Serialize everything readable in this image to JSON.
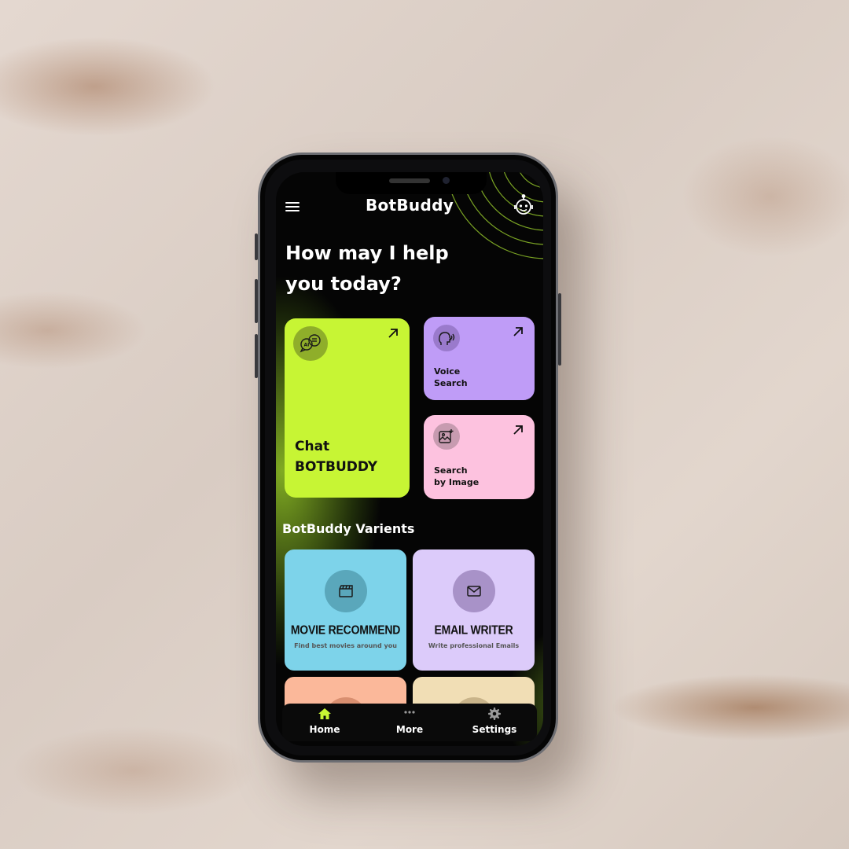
{
  "app": {
    "title": "BotBuddy"
  },
  "greeting": {
    "line1": "How may I help",
    "line2": "you today?"
  },
  "cards": {
    "chat": {
      "line1": "Chat",
      "line2": "BOTBUDDY",
      "icon": "ai-chat-icon",
      "color": "#c7f534"
    },
    "voice": {
      "line1": "Voice",
      "line2": "Search",
      "icon": "voice-head-icon",
      "color": "#bf9cf7"
    },
    "image": {
      "line1": "Search",
      "line2": "by Image",
      "icon": "image-search-icon",
      "color": "#fdc2df"
    }
  },
  "variants": {
    "title": "BotBuddy Varients",
    "items": [
      {
        "name": "MOVIE RECOMMEND",
        "desc": "Find best movies around you",
        "icon": "clapperboard-icon",
        "color": "#7dd3ea"
      },
      {
        "name": "EMAIL WRITER",
        "desc": "Write professional Emails",
        "icon": "mail-icon",
        "color": "#dccbfa"
      },
      {
        "color": "#fbb89a"
      },
      {
        "color": "#f1deb5"
      }
    ]
  },
  "nav": {
    "items": [
      {
        "label": "Home",
        "icon": "home-icon",
        "active_color": "#c7f534"
      },
      {
        "label": "More",
        "icon": "dots-icon"
      },
      {
        "label": "Settings",
        "icon": "gear-icon"
      }
    ]
  }
}
